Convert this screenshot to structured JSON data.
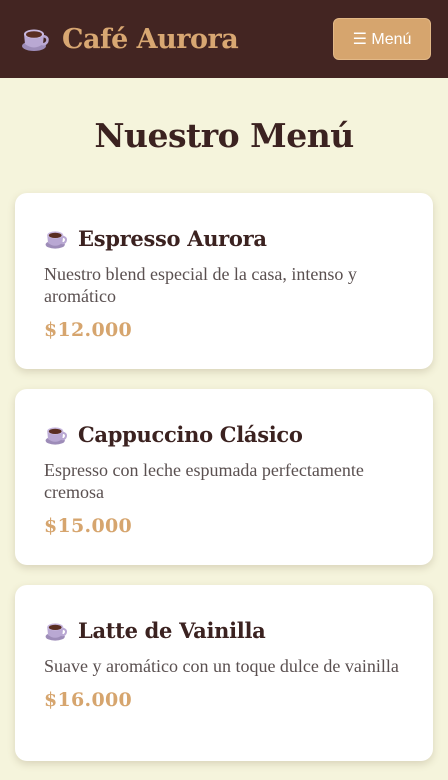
{
  "header": {
    "brand_name": "Café Aurora",
    "logo_icon": "coffee-cup-icon",
    "menu_button_label": "☰ Menú"
  },
  "page": {
    "title": "Nuestro Menú"
  },
  "colors": {
    "header_bg": "#432522",
    "accent": "#d6a56e",
    "page_bg": "#f5f4dc",
    "text_dark": "#3b2220"
  },
  "items": [
    {
      "icon": "coffee-cup-icon",
      "name": "Espresso Aurora",
      "description": "Nuestro blend especial de la casa, intenso y aromático",
      "price": "$12.000"
    },
    {
      "icon": "coffee-cup-icon",
      "name": "Cappuccino Clásico",
      "description": "Espresso con leche espumada perfectamente cremosa",
      "price": "$15.000"
    },
    {
      "icon": "coffee-cup-icon",
      "name": "Latte de Vainilla",
      "description": "Suave y aromático con un toque dulce de vainilla",
      "price": "$16.000"
    }
  ]
}
